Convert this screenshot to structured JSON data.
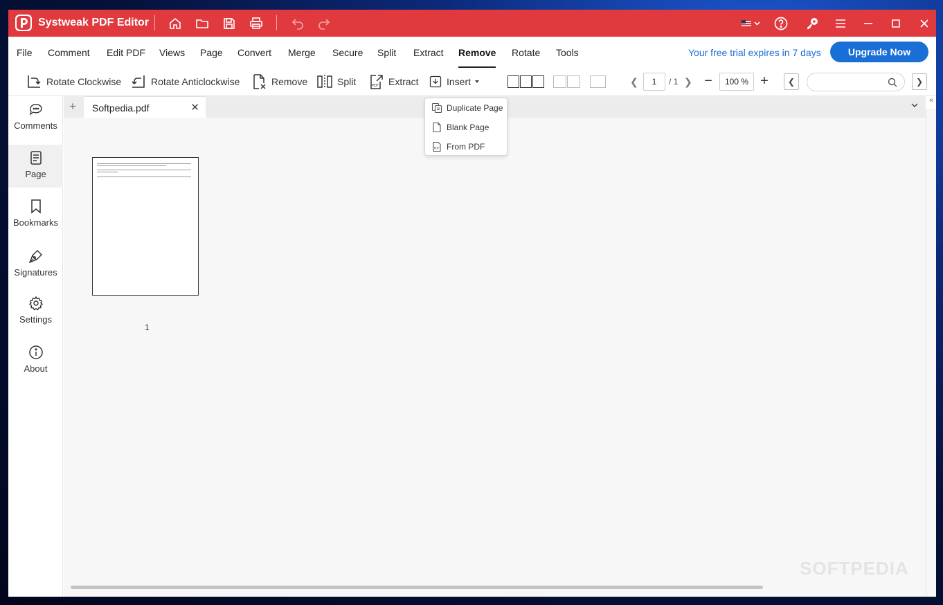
{
  "titlebar": {
    "title": "Systweak PDF Editor",
    "icons": [
      "home-icon",
      "folder-icon",
      "save-icon",
      "print-icon",
      "undo-icon",
      "redo-icon",
      "flag-icon",
      "help-icon",
      "key-icon",
      "menu-icon",
      "minimize-icon",
      "maximize-icon",
      "close-icon"
    ],
    "color": "#e0393e"
  },
  "menubar": {
    "items": [
      "File",
      "Comment",
      "Edit PDF",
      "Views",
      "Page",
      "Convert",
      "Merge",
      "Secure",
      "Split",
      "Extract",
      "Remove",
      "Rotate",
      "Tools"
    ],
    "active": "Remove",
    "trial_text": "Your free trial expires in 7 days",
    "upgrade_label": "Upgrade Now",
    "accent": "#1a6fd6"
  },
  "toolbar": {
    "rotate_cw": "Rotate Clockwise",
    "rotate_acw": "Rotate Anticlockwise",
    "remove": "Remove",
    "split": "Split",
    "extract": "Extract",
    "insert": "Insert",
    "page_current": "1",
    "page_total": "/ 1",
    "zoom": "100 %"
  },
  "insert_menu": {
    "items": [
      "Duplicate Page",
      "Blank Page",
      "From PDF"
    ]
  },
  "sidebar": {
    "items": [
      "Comments",
      "Page",
      "Bookmarks",
      "Signatures",
      "Settings",
      "About"
    ],
    "active": "Page"
  },
  "tabs": {
    "active_file": "Softpedia.pdf"
  },
  "document": {
    "page_number": "1"
  },
  "watermark": "SOFTPEDIA"
}
